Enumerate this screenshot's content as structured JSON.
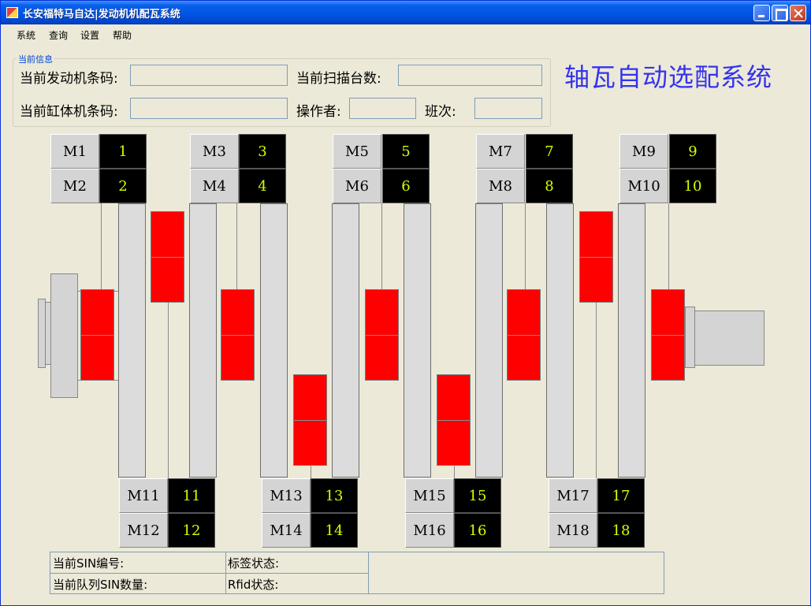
{
  "window": {
    "title": "长安福特马自达|发动机机配瓦系统"
  },
  "menu": [
    "系统",
    "查询",
    "设置",
    "帮助"
  ],
  "info_group": {
    "legend": "当前信息",
    "engine_barcode_label": "当前发动机条码:",
    "engine_barcode_value": "",
    "scan_count_label": "当前扫描台数:",
    "scan_count_value": "",
    "cylinder_barcode_label": "当前缸体机条码:",
    "cylinder_barcode_value": "",
    "operator_label": "操作者:",
    "operator_value": "",
    "shift_label": "班次:",
    "shift_value": ""
  },
  "system_title": "轴瓦自动选配系统",
  "top_bearings": [
    {
      "label": "M1",
      "value": "1"
    },
    {
      "label": "M2",
      "value": "2"
    },
    {
      "label": "M3",
      "value": "3"
    },
    {
      "label": "M4",
      "value": "4"
    },
    {
      "label": "M5",
      "value": "5"
    },
    {
      "label": "M6",
      "value": "6"
    },
    {
      "label": "M7",
      "value": "7"
    },
    {
      "label": "M8",
      "value": "8"
    },
    {
      "label": "M9",
      "value": "9"
    },
    {
      "label": "M10",
      "value": "10"
    }
  ],
  "bottom_bearings": [
    {
      "label": "M11",
      "value": "11"
    },
    {
      "label": "M12",
      "value": "12"
    },
    {
      "label": "M13",
      "value": "13"
    },
    {
      "label": "M14",
      "value": "14"
    },
    {
      "label": "M15",
      "value": "15"
    },
    {
      "label": "M16",
      "value": "16"
    },
    {
      "label": "M17",
      "value": "17"
    },
    {
      "label": "M18",
      "value": "18"
    }
  ],
  "colors": {
    "bearing_status": "#ff0000",
    "value_text": "#d4ff00",
    "title_blue": "#3333ee"
  },
  "status_table": {
    "sin_label": "当前SIN编号:",
    "tag_status_label": "标签状态:",
    "queue_label": "当前队列SIN数量:",
    "rfid_label": "Rfid状态:"
  }
}
